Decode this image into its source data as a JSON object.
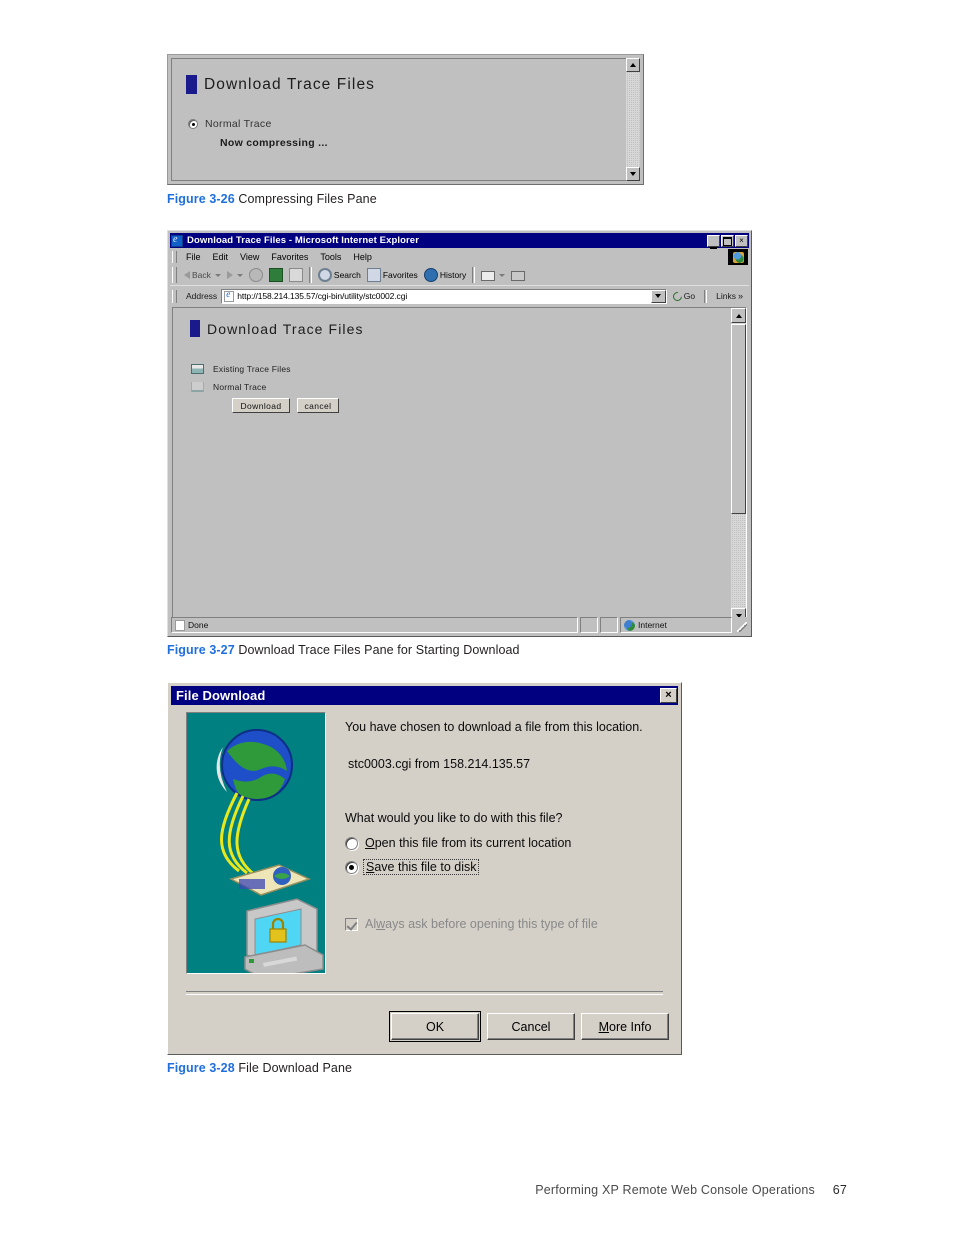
{
  "figures": [
    {
      "id": "3-26",
      "caption_number": "Figure 3-26",
      "caption_text": "Compressing Files Pane",
      "pane": {
        "title": "Download Trace Files",
        "radio_label": "Normal Trace",
        "status_text": "Now compressing ...",
        "title_marker_color": "#1a1a8c"
      }
    },
    {
      "id": "3-27",
      "caption_number": "Figure 3-27",
      "caption_text": "Download Trace Files Pane for Starting Download",
      "browser": {
        "titlebar": {
          "title": "Download Trace Files - Microsoft Internet Explorer",
          "icon": "ie-document-icon",
          "minimize": "_",
          "maximize": "□",
          "close": "×"
        },
        "menu": [
          "File",
          "Edit",
          "View",
          "Favorites",
          "Tools",
          "Help"
        ],
        "toolbar": [
          {
            "label": "Back",
            "icon": "back-arrow-icon",
            "enabled": false,
            "dropdown": true
          },
          {
            "label": "",
            "icon": "forward-arrow-icon",
            "enabled": false,
            "dropdown": true
          },
          {
            "label": "",
            "icon": "stop-icon",
            "enabled": false
          },
          {
            "label": "",
            "icon": "refresh-icon",
            "enabled": true
          },
          {
            "label": "",
            "icon": "home-icon",
            "enabled": true
          },
          {
            "label": "Search",
            "icon": "search-icon",
            "enabled": true
          },
          {
            "label": "Favorites",
            "icon": "favorites-icon",
            "enabled": true
          },
          {
            "label": "History",
            "icon": "history-icon",
            "enabled": true
          },
          {
            "label": "",
            "icon": "mail-icon",
            "enabled": true,
            "dropdown": true
          },
          {
            "label": "",
            "icon": "print-icon",
            "enabled": true
          }
        ],
        "address": {
          "label": "Address",
          "value": "http://158.214.135.57/cgi-bin/utility/stc0002.cgi",
          "go_label": "Go",
          "links_label": "Links",
          "links_chevron": "»"
        },
        "page": {
          "title": "Download Trace Files",
          "tree": [
            {
              "label": "Existing Trace Files",
              "icon": "folder-closed-icon"
            },
            {
              "label": "Normal Trace",
              "icon": "folder-open-icon"
            }
          ],
          "buttons": [
            {
              "label": "Download"
            },
            {
              "label": "cancel"
            }
          ]
        },
        "statusbar": {
          "status": "Done",
          "zone": "Internet",
          "zone_icon": "globe-icon"
        }
      }
    },
    {
      "id": "3-28",
      "caption_number": "Figure 3-28",
      "caption_text": "File Download Pane",
      "dialog": {
        "title": "File Download",
        "close_label": "×",
        "artwork": "globe-to-computer-download-illustration",
        "line1": "You have chosen to download a file from this location.",
        "line2": "stc0003.cgi  from  158.214.135.57",
        "question": "What would you like to do with this file?",
        "options": [
          {
            "label_pre": "",
            "accel": "O",
            "label_post": "pen this file from its current location",
            "selected": false,
            "disabled": false,
            "focused": false
          },
          {
            "label_pre": "",
            "accel": "S",
            "label_post": "ave this file to disk",
            "selected": true,
            "disabled": false,
            "focused": true
          }
        ],
        "checkbox": {
          "label_pre": "Al",
          "accel": "w",
          "label_post": "ays ask before opening this type of file",
          "checked": true,
          "disabled": true
        },
        "buttons": [
          {
            "label": "OK",
            "default": true
          },
          {
            "label": "Cancel",
            "default": false
          },
          {
            "label": "More Info",
            "default": false,
            "accel": "M"
          }
        ]
      }
    }
  ],
  "footer": {
    "text": "Performing XP Remote Web Console Operations",
    "page_number": "67"
  }
}
